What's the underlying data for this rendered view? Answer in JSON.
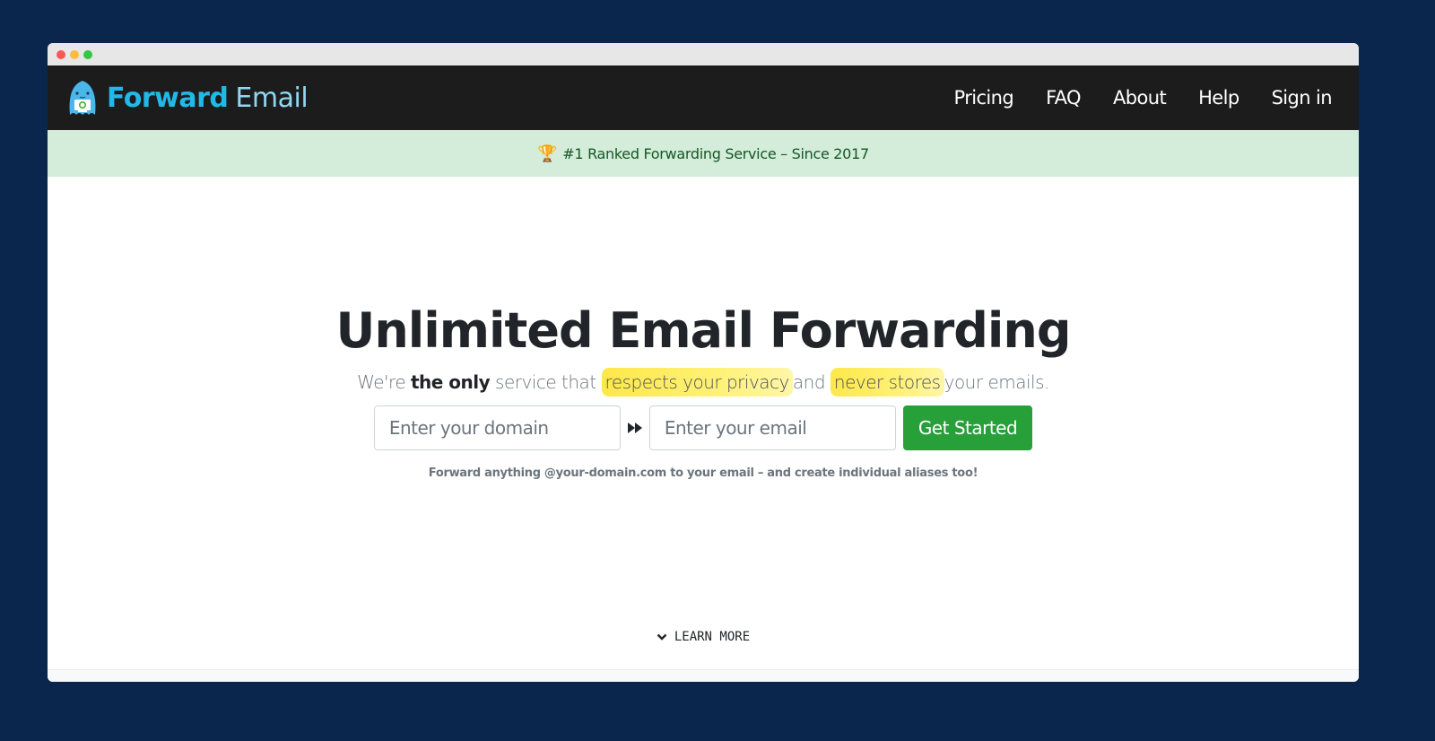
{
  "window": {
    "controls": [
      "close",
      "minimize",
      "maximize"
    ]
  },
  "navbar": {
    "brand": {
      "part1": "Forward",
      "part2": "Email",
      "logo_icon": "blue-mascot-logo"
    },
    "links": [
      {
        "label": "Pricing"
      },
      {
        "label": "FAQ"
      },
      {
        "label": "About"
      },
      {
        "label": "Help"
      },
      {
        "label": "Sign in"
      }
    ]
  },
  "banner": {
    "icon": "🏆",
    "text": "#1 Ranked Forwarding Service – Since 2017"
  },
  "hero": {
    "title": "Unlimited Email Forwarding",
    "subtitle": {
      "part1": "We're ",
      "bold": "the only",
      "part2": " service that",
      "highlight1": "respects your privacy",
      "part3": "and",
      "highlight2": "never stores",
      "part4": "your emails."
    },
    "form": {
      "domain_placeholder": "Enter your domain",
      "domain_value": "",
      "arrow_icon": "fast-forward-icon",
      "email_placeholder": "Enter your email",
      "email_value": "",
      "submit_label": "Get Started"
    },
    "hint": "Forward anything @your-domain.com to your email – and create individual aliases too!"
  },
  "learn_more": {
    "label": "LEARN MORE",
    "icon": "chevron-down-icon"
  },
  "colors": {
    "page_background": "#0a264c",
    "navbar": "#1c1c1c",
    "brand_primary": "#20b9e8",
    "banner_background": "#d4edda",
    "banner_text": "#155724",
    "cta_button": "#28a03a",
    "highlight": "#fde84a"
  }
}
